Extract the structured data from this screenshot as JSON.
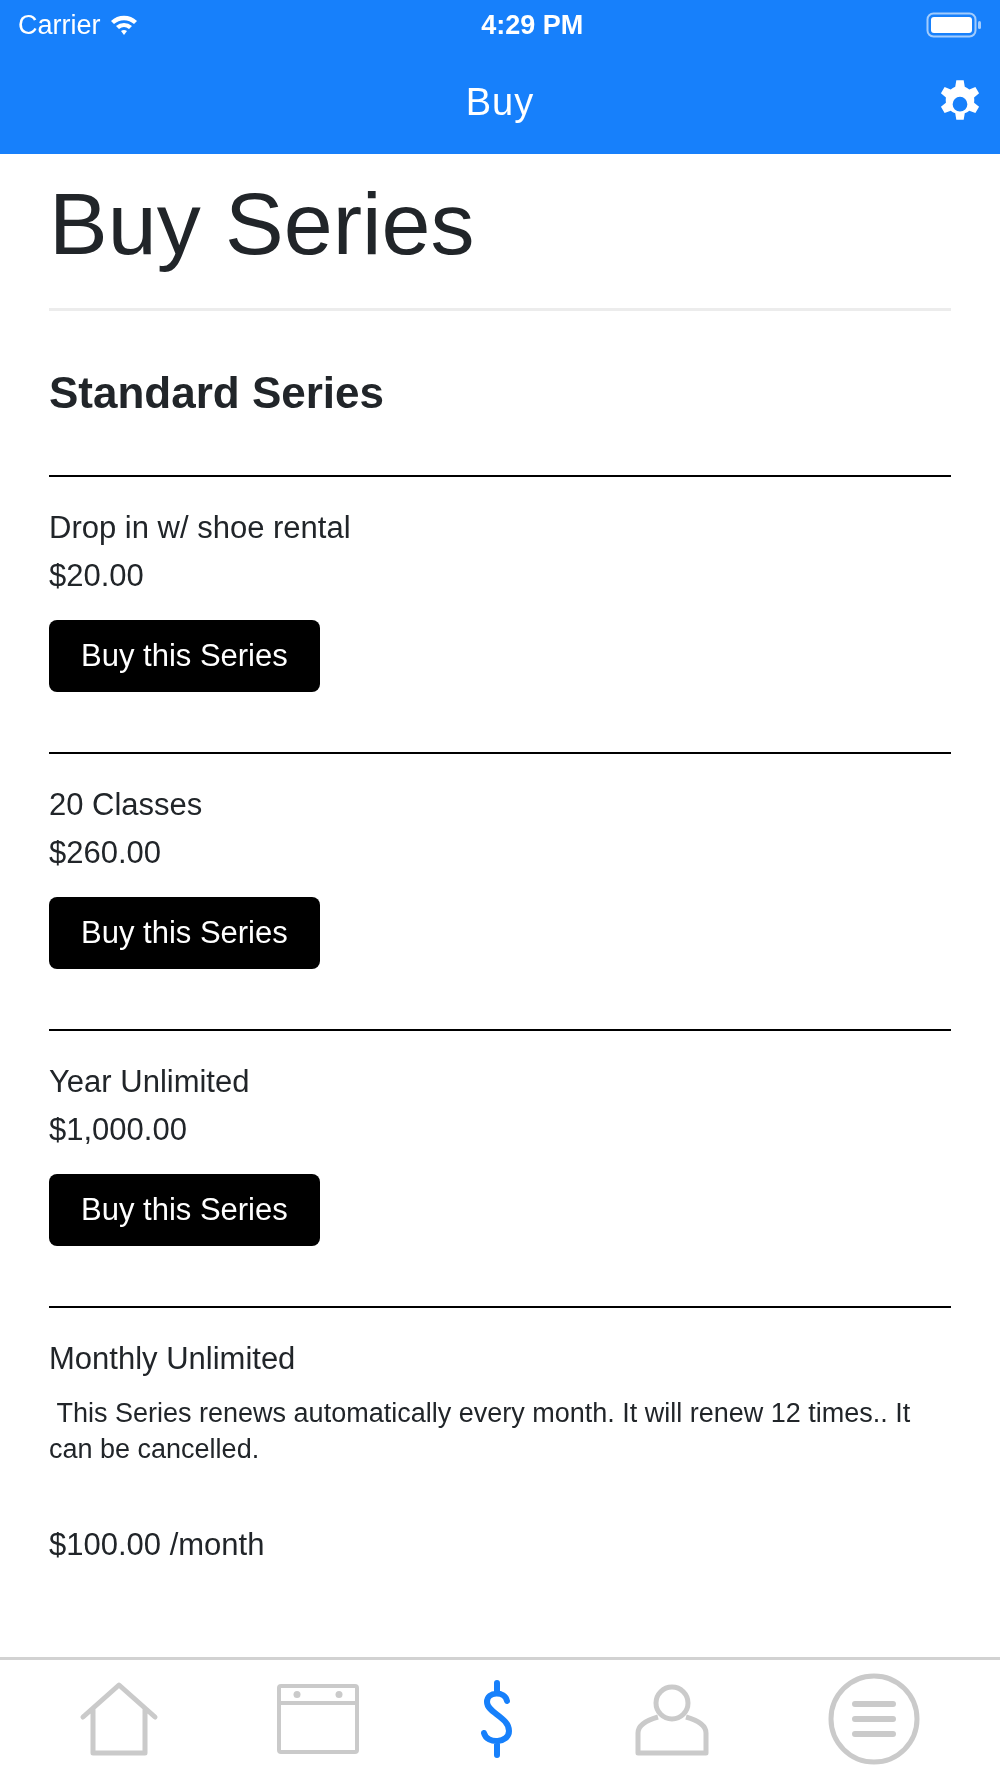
{
  "status_bar": {
    "carrier": "Carrier",
    "time": "4:29 PM"
  },
  "nav_bar": {
    "title": "Buy"
  },
  "page_title": "Buy Series",
  "section_title": "Standard Series",
  "series": [
    {
      "kind": "one-time",
      "name": "Drop in w/ shoe rental",
      "price": "$20.00",
      "button": "Buy this Series"
    },
    {
      "kind": "one-time",
      "name": "20 Classes",
      "price": "$260.00",
      "button": "Buy this Series"
    },
    {
      "kind": "one-time",
      "name": "Year Unlimited",
      "price": "$1,000.00",
      "button": "Buy this Series"
    },
    {
      "kind": "recurring",
      "name": "Monthly Unlimited",
      "description": " This Series renews automatically every month. It will renew 12 times.. It can be cancelled.",
      "price": "$100.00 /month"
    }
  ],
  "tab_bar": [
    {
      "kind": "home",
      "selected": false
    },
    {
      "kind": "calendar",
      "selected": false
    },
    {
      "kind": "dollar",
      "selected": true
    },
    {
      "kind": "profile",
      "selected": false
    },
    {
      "kind": "menu",
      "selected": false
    }
  ]
}
